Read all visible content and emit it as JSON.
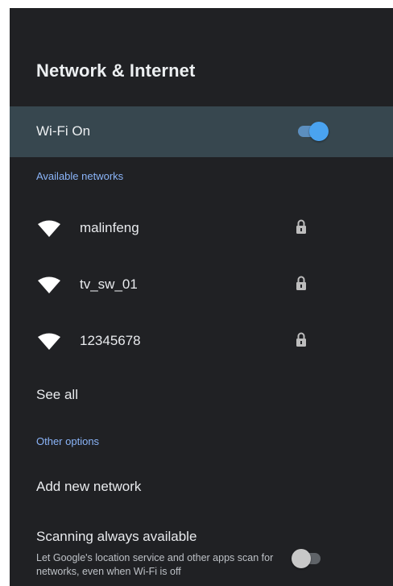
{
  "page": {
    "title": "Network & Internet"
  },
  "wifi_toggle": {
    "label": "Wi-Fi On",
    "state": "on"
  },
  "available_networks": {
    "header": "Available networks",
    "networks": [
      {
        "name": "malinfeng",
        "icon": "wifi-icon",
        "secured": true,
        "secured_icon": "lock-icon"
      },
      {
        "name": "tv_sw_01",
        "icon": "wifi-icon",
        "secured": true,
        "secured_icon": "lock-icon"
      },
      {
        "name": "12345678",
        "icon": "wifi-icon",
        "secured": true,
        "secured_icon": "lock-icon"
      }
    ],
    "see_all_label": "See all"
  },
  "other_options": {
    "header": "Other options",
    "add_network_label": "Add new network",
    "scanning": {
      "title": "Scanning always available",
      "description": "Let Google's location service and other apps scan for networks, even when Wi-Fi is off",
      "state": "off"
    }
  },
  "colors": {
    "background": "#202124",
    "highlight_row": "#37474f",
    "accent": "#8ab4f8",
    "switch_on_knob": "#4aa3f0",
    "switch_on_track": "#5c8fbf",
    "switch_off_knob": "#c8c8c8",
    "switch_off_track": "#5f6368"
  }
}
